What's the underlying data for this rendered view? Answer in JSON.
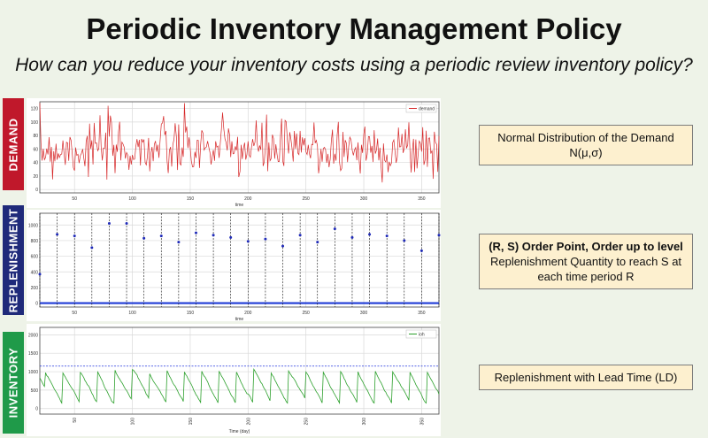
{
  "header": {
    "title": "Periodic Inventory Management Policy",
    "subtitle": "How can you reduce your inventory costs using a periodic review inventory policy?"
  },
  "side_labels": {
    "demand": "DEMAND",
    "replenishment": "REPLENISHMENT",
    "inventory": "INVENTORY"
  },
  "colors": {
    "demand": "#c0182b",
    "replenishment": "#1f2a7a",
    "inventory": "#1f9a49",
    "note_bg": "#fdf0cf"
  },
  "notes": {
    "demand": "Normal Distribution of the Demand N(μ,σ)",
    "replenishment_title": "(R, S) Order Point, Order up to level",
    "replenishment_body": "Replenishment Quantity to reach S at each time period R",
    "inventory": "Replenishment with Lead Time (LD)"
  },
  "chart_data": [
    {
      "type": "line",
      "name": "demand",
      "xlabel": "time",
      "ylabel": "",
      "xlim": [
        20,
        365
      ],
      "ylim": [
        -5,
        130
      ],
      "xticks": [
        50,
        100,
        150,
        200,
        250,
        300,
        350
      ],
      "yticks": [
        0,
        20,
        40,
        60,
        80,
        100,
        120
      ],
      "legend": {
        "position": "top-right",
        "entries": [
          "demand"
        ]
      },
      "series": [
        {
          "name": "demand",
          "color": "#d62728",
          "mean": 60,
          "std": 22,
          "start": 20,
          "end": 365
        }
      ]
    },
    {
      "type": "scatter",
      "name": "replenishment",
      "xlabel": "time",
      "ylabel": "order",
      "xlim": [
        20,
        365
      ],
      "ylim": [
        -50,
        1150
      ],
      "xticks": [
        50,
        100,
        150,
        200,
        250,
        300,
        350
      ],
      "yticks": [
        0,
        200,
        400,
        600,
        800,
        1000
      ],
      "review_period": 15,
      "points": {
        "x": [
          20,
          35,
          50,
          65,
          80,
          95,
          110,
          125,
          140,
          155,
          170,
          185,
          200,
          215,
          230,
          245,
          260,
          275,
          290,
          305,
          320,
          335,
          350,
          365
        ],
        "y": [
          370,
          880,
          860,
          710,
          1020,
          1020,
          830,
          860,
          780,
          900,
          870,
          840,
          790,
          820,
          730,
          870,
          780,
          950,
          840,
          880,
          860,
          800,
          670,
          870
        ]
      }
    },
    {
      "type": "line",
      "name": "inventory",
      "xlabel": "Time (day)",
      "ylabel": "ioh",
      "xlim": [
        20,
        365
      ],
      "ylim": [
        -150,
        2200
      ],
      "xticks": [
        50,
        100,
        150,
        200,
        250,
        300,
        350
      ],
      "yticks": [
        0,
        500,
        1000,
        1500,
        2000
      ],
      "order_up_to_level": 1150,
      "legend": {
        "position": "top-right",
        "entries": [
          "ioh"
        ]
      },
      "series": [
        {
          "name": "ioh",
          "color": "#2ca02c",
          "review_period": 15,
          "lead_time": 5,
          "daily_demand": 60
        }
      ]
    }
  ]
}
